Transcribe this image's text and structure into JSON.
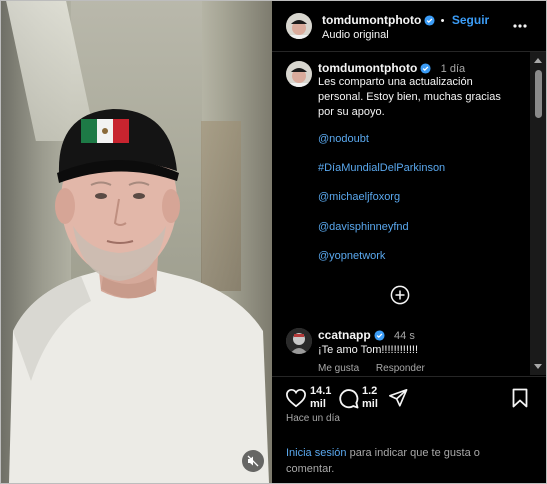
{
  "post": {
    "username": "tomdumontphoto",
    "follow_label": "Seguir",
    "separator": "•",
    "audio_label": "Audio original",
    "caption": {
      "username": "tomdumontphoto",
      "time": "1 día",
      "text": "Les comparto una actualización personal. Estoy bien, muchas gracias por su apoyo.",
      "tags": [
        "@nodoubt",
        "#DíaMundialDelParkinson",
        "@michaeljfoxorg",
        "@davisphinneyfnd",
        "@yopnetwork"
      ]
    },
    "comment": {
      "username": "ccatnapp",
      "time": "44 s",
      "text": "¡Te amo Tom!!!!!!!!!!!!",
      "like_label": "Me gusta",
      "reply_label": "Responder"
    },
    "likes": {
      "value": "14.1",
      "unit": "mil"
    },
    "comments_count": {
      "value": "1.2",
      "unit": "mil"
    },
    "posted_ago": "Hace un día",
    "login": {
      "link": "Inicia sesión",
      "rest": " para indicar que te gusta o comentar."
    }
  },
  "colors": {
    "accent": "#3b9cf6",
    "link": "#5aa8ee",
    "background": "#000000",
    "muted": "#a8a8a8"
  },
  "icons": [
    "verified-badge-icon",
    "more-options-icon",
    "add-comment-icon",
    "heart-icon",
    "comment-icon",
    "share-icon",
    "bookmark-icon",
    "mute-icon"
  ]
}
